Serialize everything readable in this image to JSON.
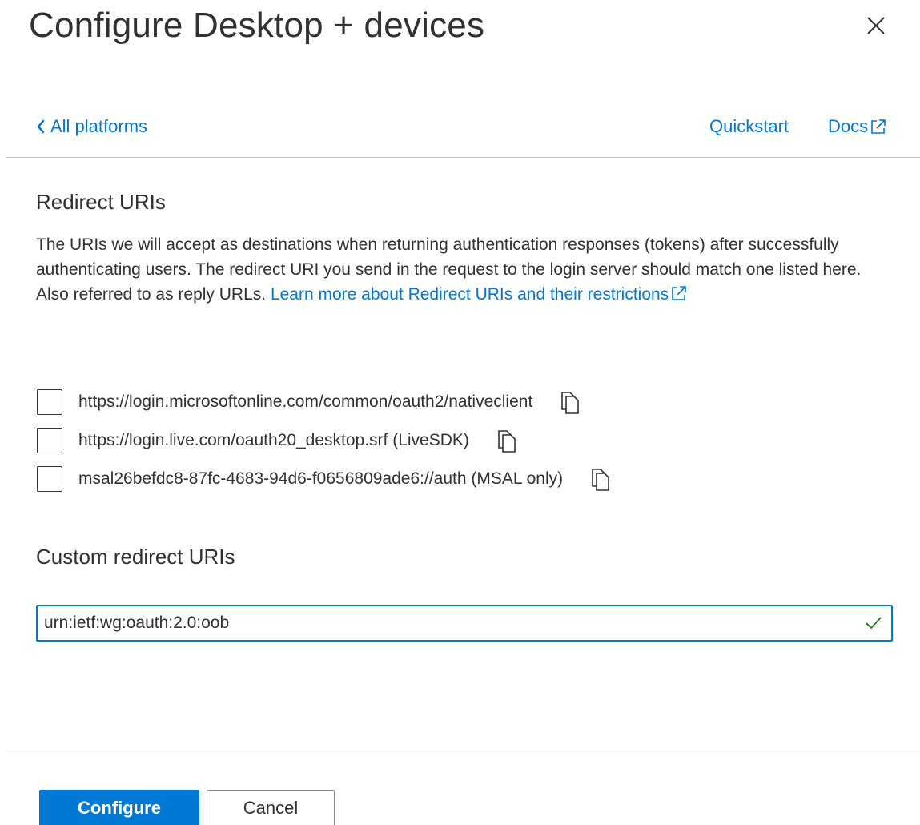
{
  "panel": {
    "title": "Configure Desktop + devices"
  },
  "nav": {
    "back_label": "All platforms",
    "quickstart_label": "Quickstart",
    "docs_label": "Docs"
  },
  "redirect": {
    "heading": "Redirect URIs",
    "description": "The URIs we will accept as destinations when returning authentication responses (tokens) after successfully authenticating users. The redirect URI you send in the request to the login server should match one listed here. Also referred to as reply URLs. ",
    "learn_more_label": "Learn more about Redirect URIs and their restrictions",
    "uris": [
      {
        "label": "https://login.microsoftonline.com/common/oauth2/nativeclient",
        "checked": false
      },
      {
        "label": "https://login.live.com/oauth20_desktop.srf (LiveSDK)",
        "checked": false
      },
      {
        "label": "msal26befdc8-87fc-4683-94d6-f0656809ade6://auth (MSAL only)",
        "checked": false
      }
    ]
  },
  "custom": {
    "heading": "Custom redirect URIs",
    "value": "urn:ietf:wg:oauth:2.0:oob"
  },
  "footer": {
    "configure_label": "Configure",
    "cancel_label": "Cancel"
  },
  "colors": {
    "accent": "#0078d4",
    "text": "#323130",
    "valid": "#107c10",
    "divider": "#c8c6c4"
  },
  "icons": [
    "close-icon",
    "chevron-left-icon",
    "external-link-icon",
    "copy-icon",
    "checkmark-icon"
  ]
}
